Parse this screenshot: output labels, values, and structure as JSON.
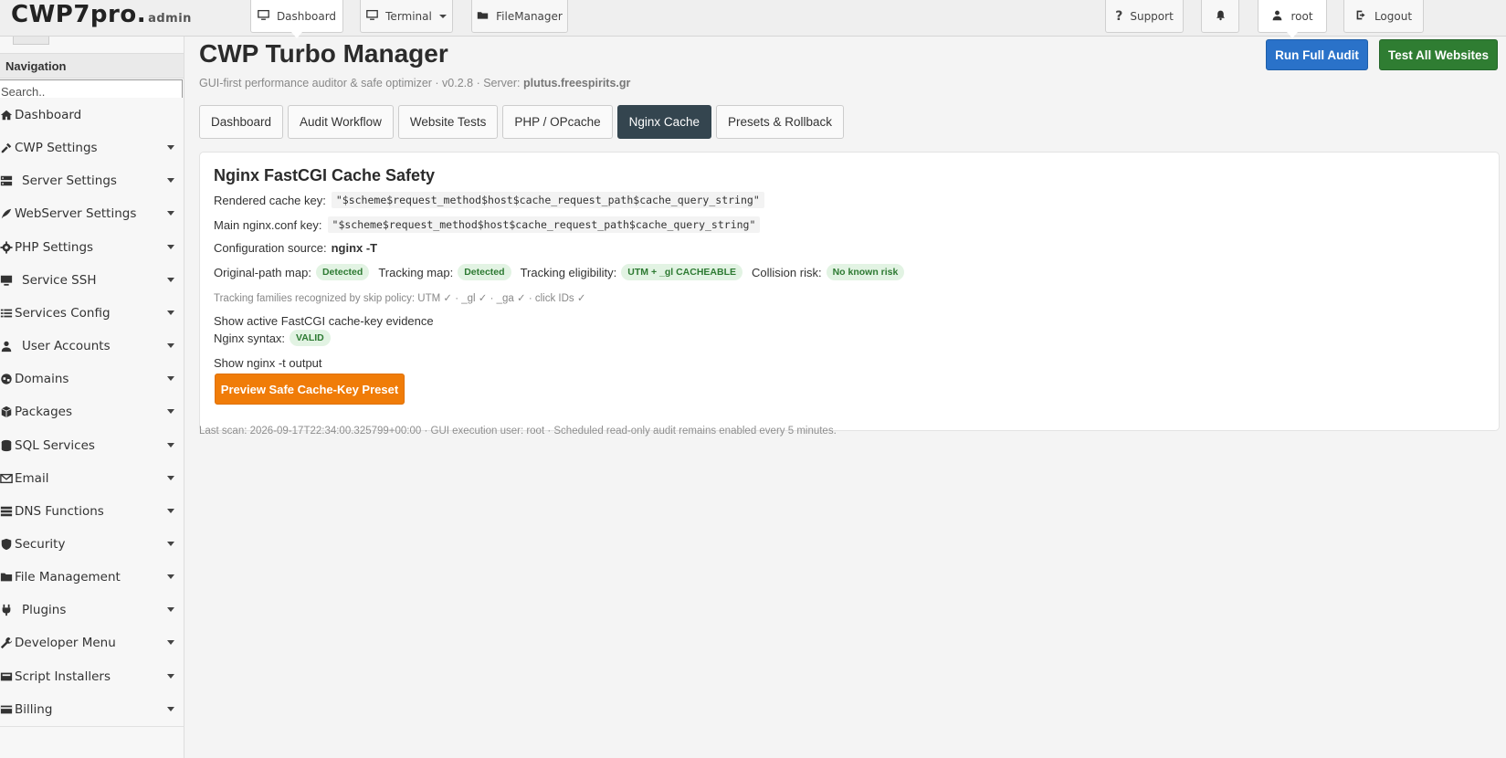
{
  "topbar": {
    "brand": "CWP7pro.",
    "brand_suffix": "admin",
    "dashboard_label": "Dashboard",
    "terminal_label": "Terminal",
    "filemanager_label": "FileManager",
    "support_label": "Support",
    "notification_count": "0",
    "user_label": "root",
    "logout_label": "Logout"
  },
  "sidebar": {
    "title": "Navigation",
    "search_placeholder": "Search..",
    "items": [
      {
        "label": "Dashboard",
        "icon": "home-icon",
        "dropdown": false
      },
      {
        "label": "CWP Settings",
        "icon": "tools-icon",
        "dropdown": true
      },
      {
        "label": "Server Settings",
        "icon": "server-icon",
        "dropdown": true
      },
      {
        "label": "WebServer Settings",
        "icon": "feather-icon",
        "dropdown": true
      },
      {
        "label": "PHP Settings",
        "icon": "gear-icon",
        "dropdown": true
      },
      {
        "label": "Service SSH",
        "icon": "monitor-icon",
        "dropdown": true
      },
      {
        "label": "Services Config",
        "icon": "list-icon",
        "dropdown": true
      },
      {
        "label": "User Accounts",
        "icon": "user-icon",
        "dropdown": true
      },
      {
        "label": "Domains",
        "icon": "globe-icon",
        "dropdown": true
      },
      {
        "label": "Packages",
        "icon": "package-icon",
        "dropdown": true
      },
      {
        "label": "SQL Services",
        "icon": "database-icon",
        "dropdown": true
      },
      {
        "label": "Email",
        "icon": "envelope-icon",
        "dropdown": true
      },
      {
        "label": "DNS Functions",
        "icon": "dns-icon",
        "dropdown": true
      },
      {
        "label": "Security",
        "icon": "shield-icon",
        "dropdown": true
      },
      {
        "label": "File Management",
        "icon": "folder-icon",
        "dropdown": true
      },
      {
        "label": "Plugins",
        "icon": "plug-icon",
        "dropdown": true
      },
      {
        "label": "Developer Menu",
        "icon": "wrench-icon",
        "dropdown": true
      },
      {
        "label": "Script Installers",
        "icon": "box-icon",
        "dropdown": true
      },
      {
        "label": "Billing",
        "icon": "billing-icon",
        "dropdown": true
      }
    ]
  },
  "main": {
    "title": "CWP Turbo Manager",
    "subtitle_prefix": "GUI-first performance auditor & safe optimizer · v0.2.8 · Server:",
    "server": "plutus.freespirits.gr",
    "run_audit_label": "Run Full Audit",
    "test_websites_label": "Test All Websites",
    "tabs": [
      {
        "label": "Dashboard",
        "active": false
      },
      {
        "label": "Audit Workflow",
        "active": false
      },
      {
        "label": "Website Tests",
        "active": false
      },
      {
        "label": "PHP / OPcache",
        "active": false
      },
      {
        "label": "Nginx Cache",
        "active": true
      },
      {
        "label": "Presets & Rollback",
        "active": false
      }
    ],
    "card": {
      "title": "Nginx FastCGI Cache Safety",
      "rendered_key_label": "Rendered cache key:",
      "rendered_key_value": "\"$scheme$request_method$host$cache_request_path$cache_query_string\"",
      "main_key_label": "Main nginx.conf key:",
      "main_key_value": "\"$scheme$request_method$host$cache_request_path$cache_query_string\"",
      "config_source_label": "Configuration source:",
      "config_source_value": "nginx -T",
      "original_path_label": "Original-path map:",
      "original_path_value": "Detected",
      "tracking_map_label": "Tracking map:",
      "tracking_map_value": "Detected",
      "tracking_eligibility_label": "Tracking eligibility:",
      "tracking_eligibility_value": "UTM + _gl CACHEABLE",
      "collision_label": "Collision risk:",
      "collision_value": "No known risk",
      "families_note": "Tracking families recognized by skip policy: UTM ✓ · _gl ✓ · _ga ✓ · click IDs ✓",
      "evidence_toggle": "Show active FastCGI cache-key evidence",
      "syntax_label": "Nginx syntax:",
      "syntax_value": "VALID",
      "nginx_output_toggle": "Show nginx -t output",
      "preview_button": "Preview Safe Cache-Key Preset"
    },
    "footer_note": "Last scan: 2026-09-17T22:34:00.325799+00:00 · GUI execution user: root · Scheduled read-only audit remains enabled every 5 minutes."
  }
}
